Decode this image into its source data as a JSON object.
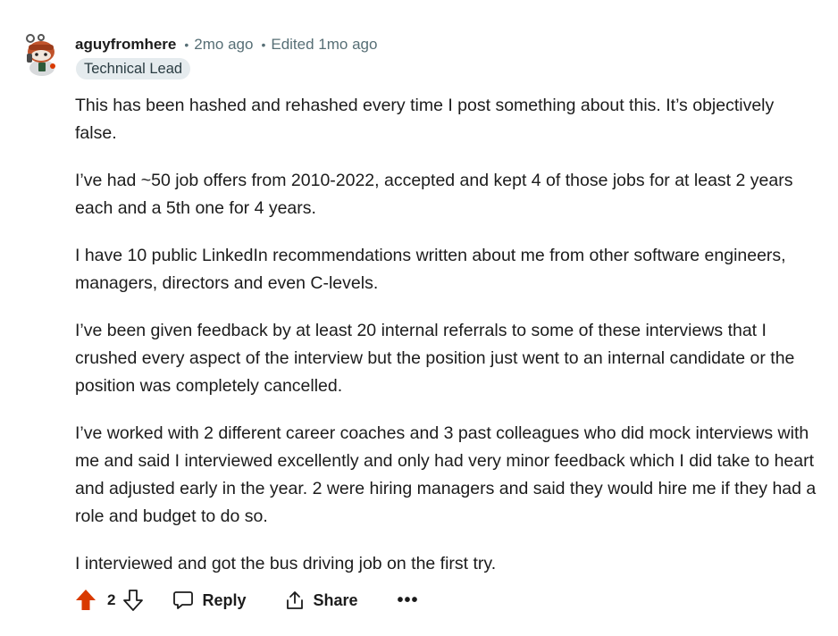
{
  "comment": {
    "author": "aguyfromhere",
    "posted": "2mo ago",
    "edited": "Edited 1mo ago",
    "flair": "Technical Lead",
    "paragraphs": [
      "This has been hashed and rehashed every time I post something about this. It’s objectively false.",
      "I’ve had ~50 job offers from 2010-2022, accepted and kept 4 of those jobs for at least 2 years each and a 5th one for 4 years.",
      "I have 10 public LinkedIn recommendations written about me from other software engineers, managers, directors and even C-levels.",
      "I’ve been given feedback by at least 20 internal referrals to some of these interviews that I crushed every aspect of the interview but the position just went to an internal candidate or the position was completely cancelled.",
      "I’ve worked with 2 different career coaches and 3 past colleagues who did mock interviews with me and said I interviewed excellently and only had very minor feedback which I did take to heart and adjusted early in the year. 2 were hiring managers and said they would hire me if they had a role and budget to do so.",
      "I interviewed and got the bus driving job on the first try."
    ]
  },
  "actions": {
    "vote_count": "2",
    "reply_label": "Reply",
    "share_label": "Share",
    "more_label": "•••"
  },
  "separator": "•",
  "icons": {
    "avatar": "snoo-avatar-icon",
    "upvote": "upvote-arrow-icon",
    "downvote": "downvote-arrow-icon",
    "reply": "speech-bubble-icon",
    "share": "share-arrow-icon"
  },
  "colors": {
    "upvote_active": "#d93a00",
    "meta_text": "#576f76",
    "flair_bg": "#e5ebee"
  }
}
